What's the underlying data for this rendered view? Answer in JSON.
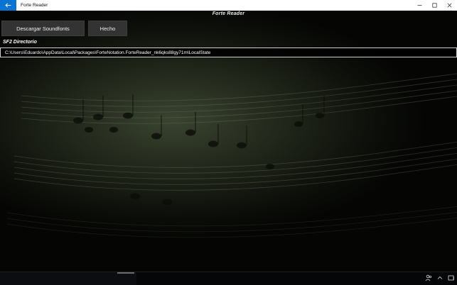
{
  "window": {
    "title": "Forte Reader",
    "icons": {
      "back": "back-arrow-icon",
      "minimize": "minimize-icon",
      "maximize": "maximize-icon",
      "close": "close-icon"
    }
  },
  "header": {
    "brand": "Forte Reader"
  },
  "actions": {
    "download_soundfonts_label": "Descargar Soundfonts",
    "done_label": "Hecho"
  },
  "sf2": {
    "label": "SF2 Directorio",
    "path": "C:\\Users\\Eduardo\\AppData\\Local\\Packages\\ForteNotation.ForteReader_nk6qks88gy71m\\LocalState"
  },
  "taskbar": {
    "icons": [
      "people-icon",
      "chevron-up-icon",
      "tablet-icon"
    ]
  },
  "colors": {
    "accent": "#0a74d4",
    "button_bg": "#333333",
    "text": "#ffffff"
  }
}
